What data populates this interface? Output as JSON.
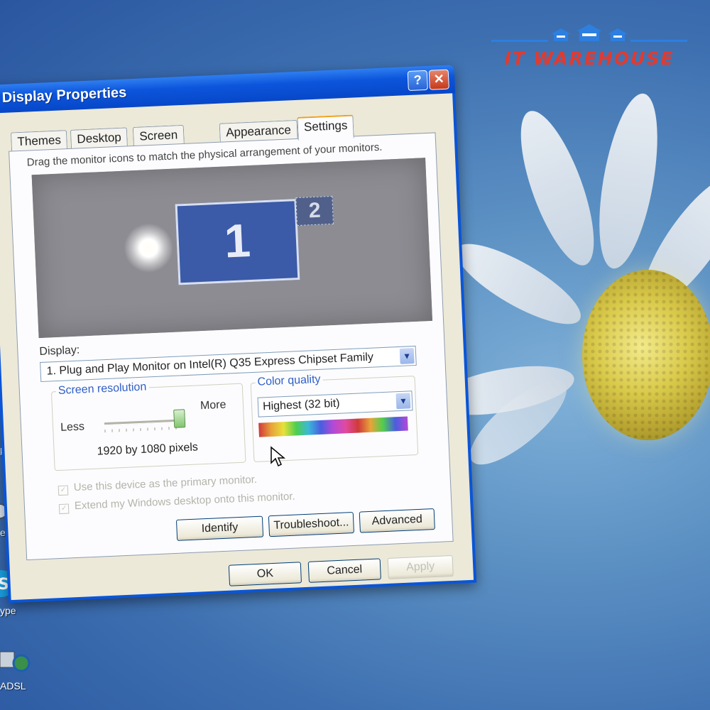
{
  "watermark": {
    "text": "IT WAREHOUSE",
    "color": "#e23a2f",
    "accent": "#2d7fe0"
  },
  "desktop_labels": [
    "kup",
    "e",
    "ype",
    "ADSL"
  ],
  "dialog": {
    "title": "Display Properties",
    "help_glyph": "?",
    "close_glyph": "✕",
    "tabs": [
      {
        "label": "Themes"
      },
      {
        "label": "Desktop"
      },
      {
        "label": "Screen Saver"
      },
      {
        "label": "Appearance"
      },
      {
        "label": "Settings",
        "active": true
      }
    ],
    "settings": {
      "instruction": "Drag the monitor icons to match the physical arrangement of your monitors.",
      "monitors": [
        {
          "number": "1"
        },
        {
          "number": "2"
        }
      ],
      "display_label": "Display:",
      "display_value": "1. Plug and Play Monitor on Intel(R) Q35 Express Chipset Family",
      "screen_resolution": {
        "title": "Screen resolution",
        "less_label": "Less",
        "more_label": "More",
        "value": "1920 by 1080 pixels",
        "slider_position": 1.0
      },
      "color_quality": {
        "title": "Color quality",
        "value": "Highest (32 bit)"
      },
      "checkboxes": [
        {
          "label": "Use this device as the primary monitor.",
          "checked": true,
          "enabled": false
        },
        {
          "label": "Extend my Windows desktop onto this monitor.",
          "checked": true,
          "enabled": false
        }
      ],
      "buttons": {
        "identify": "Identify",
        "troubleshoot": "Troubleshoot...",
        "advanced": "Advanced"
      }
    },
    "footer_buttons": {
      "ok": "OK",
      "cancel": "Cancel",
      "apply": "Apply"
    }
  }
}
